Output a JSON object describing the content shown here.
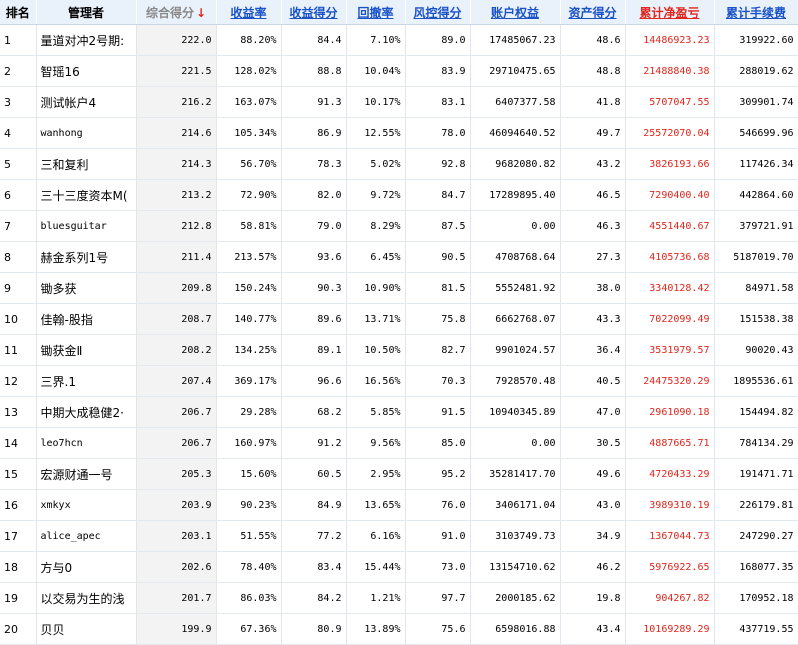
{
  "headers": {
    "rank": "排名",
    "manager": "管理者",
    "composite": "综合得分",
    "return_rate": "收益率",
    "return_score": "收益得分",
    "drawdown": "回撤率",
    "risk_score": "风控得分",
    "equity": "账户权益",
    "asset_score": "资产得分",
    "net_profit": "累计净盈亏",
    "fees": "累计手续费"
  },
  "sort_arrow": "↓",
  "colors": {
    "header_bg": "#e9f1fb",
    "link": "#1a52c7",
    "negative": "#e0261d",
    "score_bg": "#f3f3f3"
  },
  "rows": [
    {
      "rank": "1",
      "manager": "量道对冲2号期:",
      "composite": "222.0",
      "return_rate": "88.20%",
      "return_score": "84.4",
      "drawdown": "7.10%",
      "risk_score": "89.0",
      "equity": "17485067.23",
      "asset_score": "48.6",
      "net_profit": "14486923.23",
      "fees": "319922.60"
    },
    {
      "rank": "2",
      "manager": "智瑶16",
      "composite": "221.5",
      "return_rate": "128.02%",
      "return_score": "88.8",
      "drawdown": "10.04%",
      "risk_score": "83.9",
      "equity": "29710475.65",
      "asset_score": "48.8",
      "net_profit": "21488840.38",
      "fees": "288019.62"
    },
    {
      "rank": "3",
      "manager": "测试帐户4",
      "composite": "216.2",
      "return_rate": "163.07%",
      "return_score": "91.3",
      "drawdown": "10.17%",
      "risk_score": "83.1",
      "equity": "6407377.58",
      "asset_score": "41.8",
      "net_profit": "5707047.55",
      "fees": "309901.74"
    },
    {
      "rank": "4",
      "manager": "wanhong",
      "composite": "214.6",
      "return_rate": "105.34%",
      "return_score": "86.9",
      "drawdown": "12.55%",
      "risk_score": "78.0",
      "equity": "46094640.52",
      "asset_score": "49.7",
      "net_profit": "25572070.04",
      "fees": "546699.96"
    },
    {
      "rank": "5",
      "manager": "三和复利",
      "composite": "214.3",
      "return_rate": "56.70%",
      "return_score": "78.3",
      "drawdown": "5.02%",
      "risk_score": "92.8",
      "equity": "9682080.82",
      "asset_score": "43.2",
      "net_profit": "3826193.66",
      "fees": "117426.34"
    },
    {
      "rank": "6",
      "manager": "三十三度资本M(",
      "composite": "213.2",
      "return_rate": "72.90%",
      "return_score": "82.0",
      "drawdown": "9.72%",
      "risk_score": "84.7",
      "equity": "17289895.40",
      "asset_score": "46.5",
      "net_profit": "7290400.40",
      "fees": "442864.60"
    },
    {
      "rank": "7",
      "manager": "bluesguitar",
      "composite": "212.8",
      "return_rate": "58.81%",
      "return_score": "79.0",
      "drawdown": "8.29%",
      "risk_score": "87.5",
      "equity": "0.00",
      "asset_score": "46.3",
      "net_profit": "4551440.67",
      "fees": "379721.91"
    },
    {
      "rank": "8",
      "manager": "赫金系列1号",
      "composite": "211.4",
      "return_rate": "213.57%",
      "return_score": "93.6",
      "drawdown": "6.45%",
      "risk_score": "90.5",
      "equity": "4708768.64",
      "asset_score": "27.3",
      "net_profit": "4105736.68",
      "fees": "5187019.70"
    },
    {
      "rank": "9",
      "manager": "锄多获",
      "composite": "209.8",
      "return_rate": "150.24%",
      "return_score": "90.3",
      "drawdown": "10.90%",
      "risk_score": "81.5",
      "equity": "5552481.92",
      "asset_score": "38.0",
      "net_profit": "3340128.42",
      "fees": "84971.58"
    },
    {
      "rank": "10",
      "manager": "佳翰-股指",
      "composite": "208.7",
      "return_rate": "140.77%",
      "return_score": "89.6",
      "drawdown": "13.71%",
      "risk_score": "75.8",
      "equity": "6662768.07",
      "asset_score": "43.3",
      "net_profit": "7022099.49",
      "fees": "151538.38"
    },
    {
      "rank": "11",
      "manager": "锄获金Ⅱ",
      "composite": "208.2",
      "return_rate": "134.25%",
      "return_score": "89.1",
      "drawdown": "10.50%",
      "risk_score": "82.7",
      "equity": "9901024.57",
      "asset_score": "36.4",
      "net_profit": "3531979.57",
      "fees": "90020.43"
    },
    {
      "rank": "12",
      "manager": "三界.1",
      "composite": "207.4",
      "return_rate": "369.17%",
      "return_score": "96.6",
      "drawdown": "16.56%",
      "risk_score": "70.3",
      "equity": "7928570.48",
      "asset_score": "40.5",
      "net_profit": "24475320.29",
      "fees": "1895536.61"
    },
    {
      "rank": "13",
      "manager": "中期大成稳健2·",
      "composite": "206.7",
      "return_rate": "29.28%",
      "return_score": "68.2",
      "drawdown": "5.85%",
      "risk_score": "91.5",
      "equity": "10940345.89",
      "asset_score": "47.0",
      "net_profit": "2961090.18",
      "fees": "154494.82"
    },
    {
      "rank": "14",
      "manager": "leo7hcn",
      "composite": "206.7",
      "return_rate": "160.97%",
      "return_score": "91.2",
      "drawdown": "9.56%",
      "risk_score": "85.0",
      "equity": "0.00",
      "asset_score": "30.5",
      "net_profit": "4887665.71",
      "fees": "784134.29"
    },
    {
      "rank": "15",
      "manager": "宏源财通一号",
      "composite": "205.3",
      "return_rate": "15.60%",
      "return_score": "60.5",
      "drawdown": "2.95%",
      "risk_score": "95.2",
      "equity": "35281417.70",
      "asset_score": "49.6",
      "net_profit": "4720433.29",
      "fees": "191471.71"
    },
    {
      "rank": "16",
      "manager": "xmkyx",
      "composite": "203.9",
      "return_rate": "90.23%",
      "return_score": "84.9",
      "drawdown": "13.65%",
      "risk_score": "76.0",
      "equity": "3406171.04",
      "asset_score": "43.0",
      "net_profit": "3989310.19",
      "fees": "226179.81"
    },
    {
      "rank": "17",
      "manager": "alice_apec",
      "composite": "203.1",
      "return_rate": "51.55%",
      "return_score": "77.2",
      "drawdown": "6.16%",
      "risk_score": "91.0",
      "equity": "3103749.73",
      "asset_score": "34.9",
      "net_profit": "1367044.73",
      "fees": "247290.27"
    },
    {
      "rank": "18",
      "manager": "方与0",
      "composite": "202.6",
      "return_rate": "78.40%",
      "return_score": "83.4",
      "drawdown": "15.44%",
      "risk_score": "73.0",
      "equity": "13154710.62",
      "asset_score": "46.2",
      "net_profit": "5976922.65",
      "fees": "168077.35"
    },
    {
      "rank": "19",
      "manager": "以交易为生的浅",
      "composite": "201.7",
      "return_rate": "86.03%",
      "return_score": "84.2",
      "drawdown": "1.21%",
      "risk_score": "97.7",
      "equity": "2000185.62",
      "asset_score": "19.8",
      "net_profit": "904267.82",
      "fees": "170952.18"
    },
    {
      "rank": "20",
      "manager": "贝贝",
      "composite": "199.9",
      "return_rate": "67.36%",
      "return_score": "80.9",
      "drawdown": "13.89%",
      "risk_score": "75.6",
      "equity": "6598016.88",
      "asset_score": "43.4",
      "net_profit": "10169289.29",
      "fees": "437719.55"
    }
  ]
}
